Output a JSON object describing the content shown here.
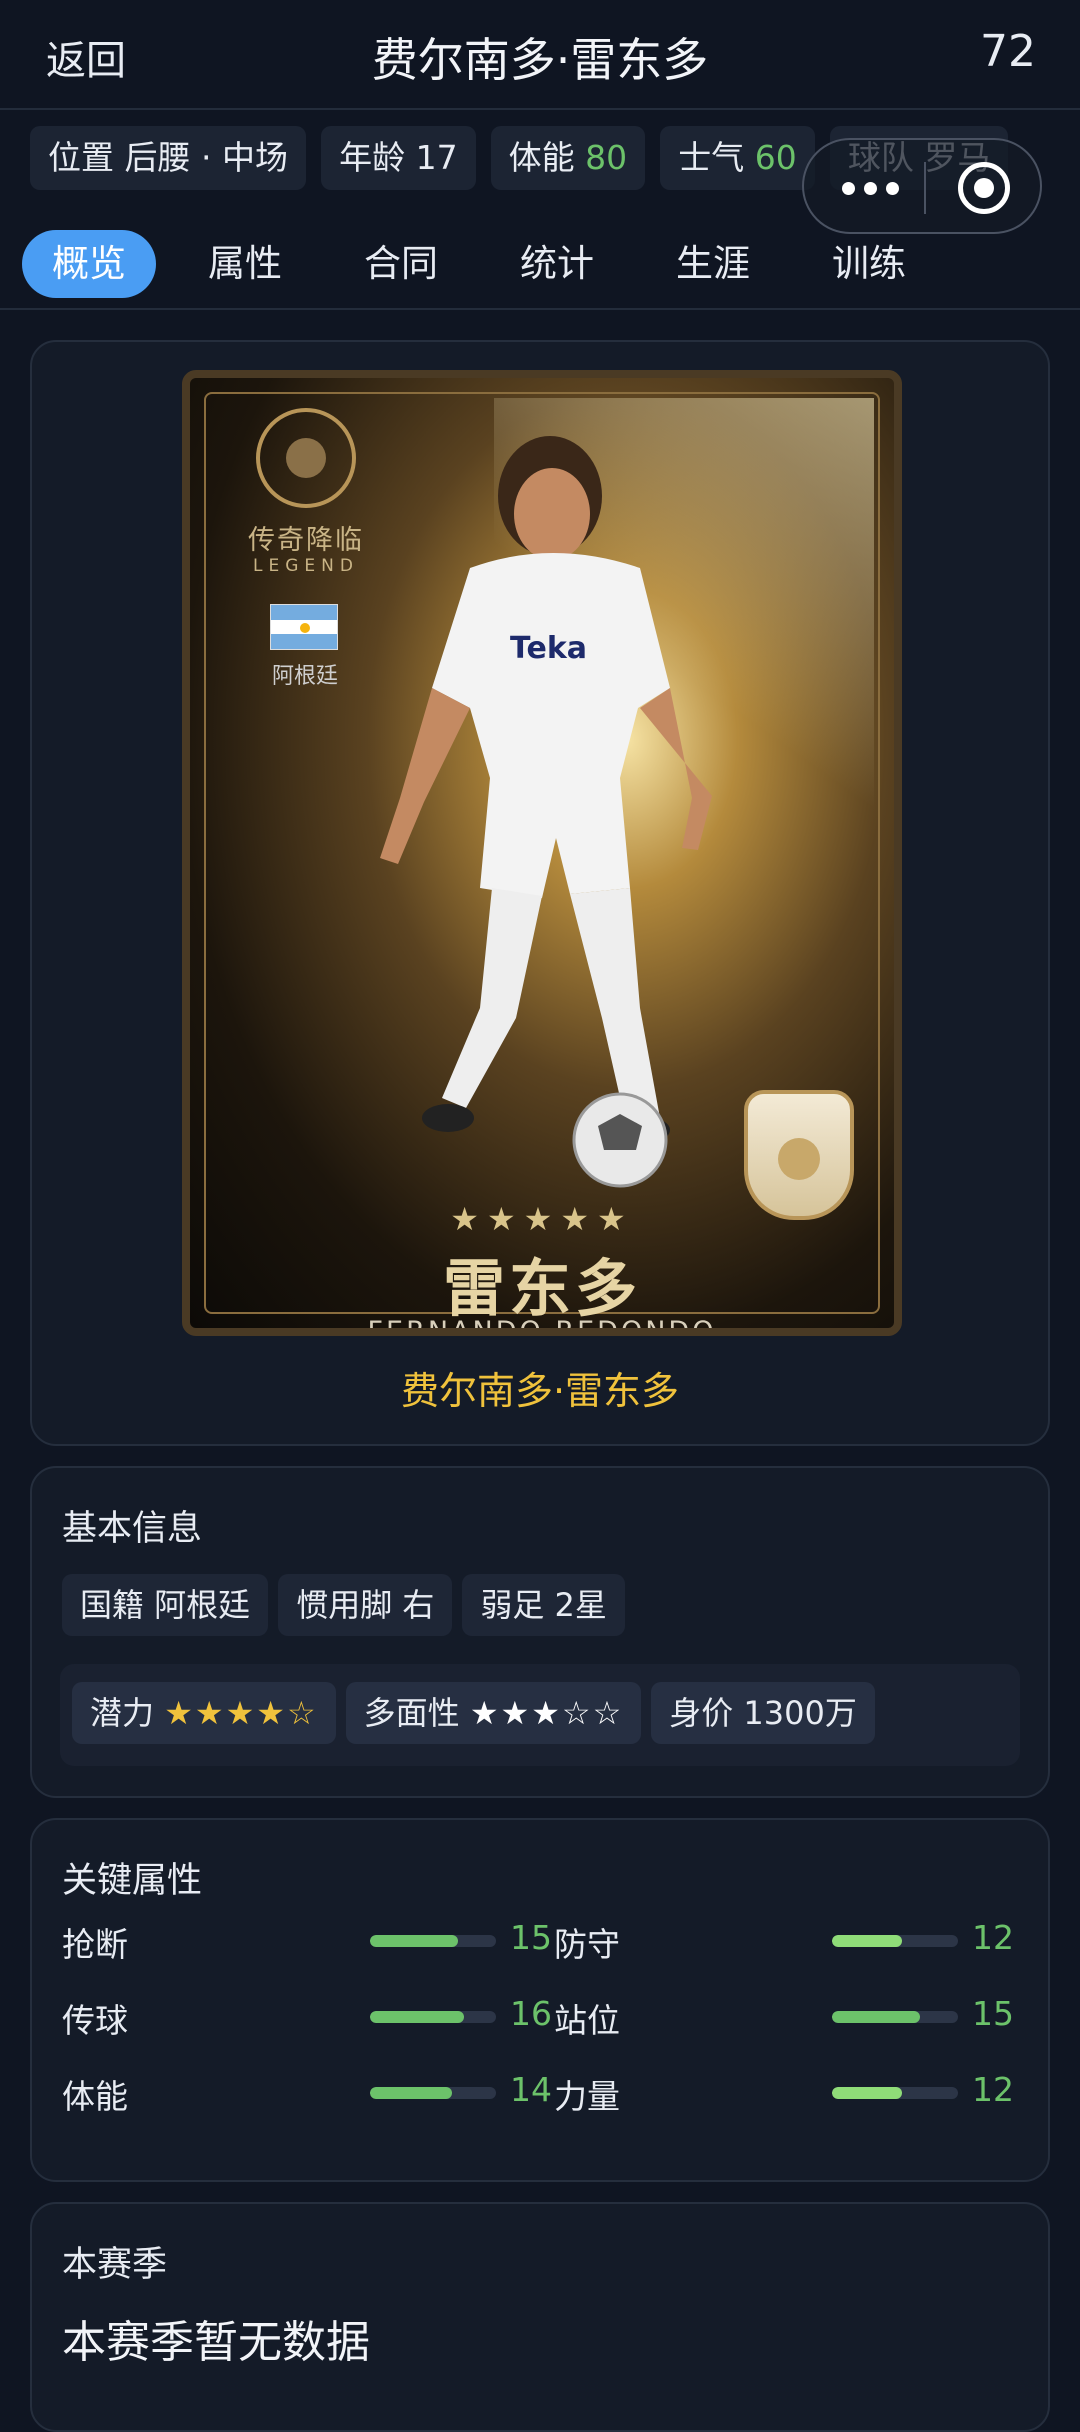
{
  "header": {
    "back_label": "返回",
    "title": "费尔南多·雷东多",
    "rating": "72"
  },
  "info_chips": [
    {
      "label": "位置",
      "value": "后腰 · 中场",
      "value_color": "#e8ecf3"
    },
    {
      "label": "年龄",
      "value": "17",
      "value_color": "#e8ecf3"
    },
    {
      "label": "体能",
      "value": "80",
      "value_color": "#6cc26a"
    },
    {
      "label": "士气",
      "value": "60",
      "value_color": "#6cc26a"
    },
    {
      "label": "球队",
      "value": "罗马",
      "value_color": "#e8ecf3"
    }
  ],
  "tabs": [
    "概览",
    "属性",
    "合同",
    "统计",
    "生涯",
    "训练"
  ],
  "active_tab": "概览",
  "player_card": {
    "legend_cn": "传奇降临",
    "legend_en": "LEGEND",
    "nation": "阿根廷",
    "stars": "★★★★★",
    "name_cn": "雷东多",
    "name_en": "FERNANDO REDONDO",
    "caption": "费尔南多·雷东多",
    "accent_color": "#f0c23c"
  },
  "basic_info": {
    "title": "基本信息",
    "nationality": "国籍 阿根廷",
    "foot": "惯用脚 右",
    "weak_foot": "弱足 2星",
    "potential_label": "潜力",
    "potential_stars_filled": "★★★★",
    "potential_stars_empty": "☆",
    "potential_rating": 4,
    "versatility_label": "多面性",
    "versatility_stars_filled": "★★★",
    "versatility_stars_empty": "☆☆",
    "versatility_rating": 3,
    "value": "身价 1300万"
  },
  "key_attributes": {
    "title": "关键属性",
    "max": 20,
    "rows": [
      {
        "left": {
          "name": "抢断",
          "value": 15
        },
        "right": {
          "name": "防守",
          "value": 12
        }
      },
      {
        "left": {
          "name": "传球",
          "value": 16
        },
        "right": {
          "name": "站位",
          "value": 15
        }
      },
      {
        "left": {
          "name": "体能",
          "value": 14
        },
        "right": {
          "name": "力量",
          "value": 12
        }
      }
    ],
    "colors": {
      "high": "#6cc26a",
      "mid": "#8fdc78",
      "value_text": "#6cc26a"
    }
  },
  "season": {
    "title": "本赛季",
    "empty_text": "本赛季暂无数据"
  },
  "icons": [
    "more-dots-icon",
    "close-target-icon",
    "legend-crest-icon",
    "argentina-flag-icon",
    "icon-badge-icon"
  ]
}
